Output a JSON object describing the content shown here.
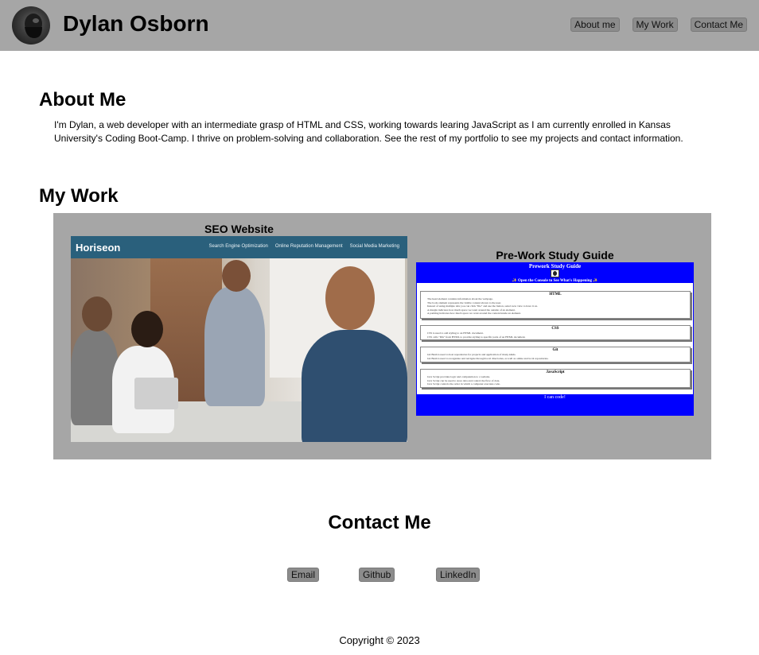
{
  "header": {
    "name": "Dylan Osborn",
    "nav": [
      "About me",
      "My Work",
      "Contact Me"
    ]
  },
  "about": {
    "heading": "About Me",
    "text": "I'm Dylan, a web developer with an intermediate grasp of HTML and CSS, working towards learing JavaScript as I am currently enrolled in Kansas University's Coding Boot-Camp. I thrive on problem-solving and collaboration. See the rest of my portfolio to see my projects and contact information."
  },
  "work": {
    "heading": "My Work",
    "projects": [
      {
        "title": "SEO Website",
        "preview": {
          "logo": "Horiseon",
          "nav": [
            "Search Engine Optimization",
            "Online Reputation Management",
            "Social Media Marketing"
          ]
        }
      },
      {
        "title": "Pre-Work Study Guide",
        "preview": {
          "title": "Prework Study Guide",
          "subtitle": "✨ Open the Console to See What's Happening ✨",
          "sections": [
            {
              "title": "HTML",
              "lines": [
                "The head element contains information about the webpage.",
                "The body element represents the visible content shown to the user.",
                "Instead of using multiple tabs you can click \"file\" and use the button, select new view to have it on.",
                "A margin indicates how much space we want around the outside of an element.",
                "A padding indicates how much space we want around the content inside an element."
              ]
            },
            {
              "title": "CSS",
              "lines": [
                "CSS is used to add styling to an HTML document.",
                "CSS calls \"IDs\" from HTML to provide styling to specific parts of an HTML document."
              ]
            },
            {
              "title": "Git",
              "lines": [
                "Git Bash is used to host repositories for projects and application of many kinds.",
                "Git Bash is used to reorganize and navigate through local directories, as well as online and local repositories."
              ]
            },
            {
              "title": "JavaScript",
              "lines": [
                "Java Script provides logic and computation to a website.",
                "Java Script can be used to store data and control the flow of data.",
                "Java Script controls the order in which a computer executes code."
              ]
            }
          ],
          "footer": "I can code!"
        }
      }
    ]
  },
  "contact": {
    "heading": "Contact Me",
    "links": [
      "Email",
      "Github",
      "LinkedIn"
    ]
  },
  "footer": {
    "copyright": "Copyright © 2023"
  }
}
